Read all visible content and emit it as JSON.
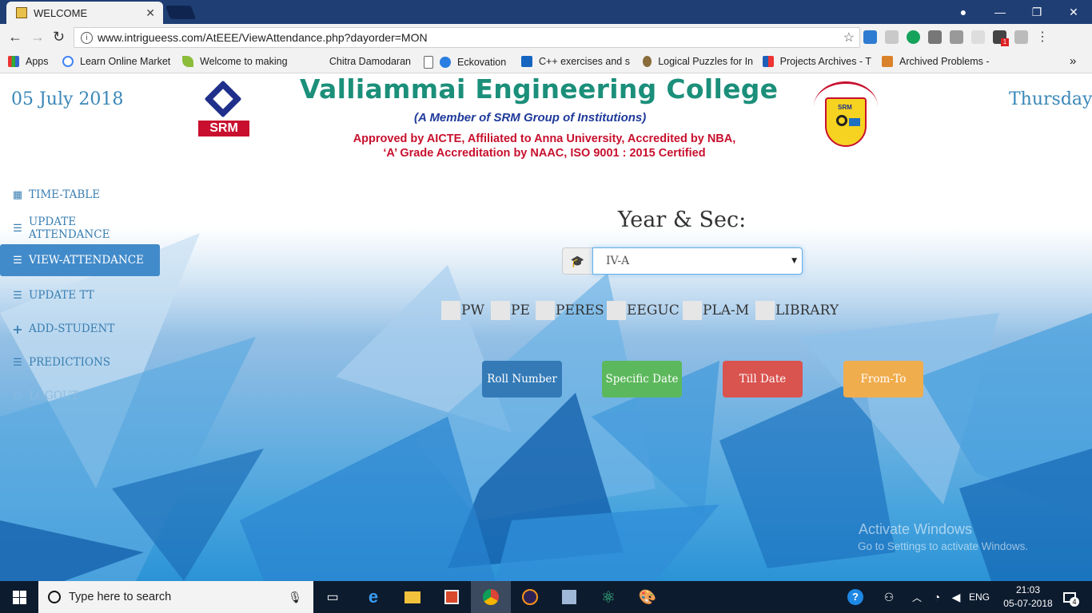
{
  "browser": {
    "tab_title": "WELCOME",
    "url": "www.intrigueess.com/AtEEE/ViewAttendance.php?dayorder=MON",
    "bookmarks": [
      {
        "label": "Apps"
      },
      {
        "label": "Learn Online Market"
      },
      {
        "label": "Welcome to making"
      },
      {
        "label": "Chitra Damodaran"
      },
      {
        "label": "Eckovation"
      },
      {
        "label": "C++ exercises and s"
      },
      {
        "label": "Logical Puzzles for In"
      },
      {
        "label": "Projects Archives - T"
      },
      {
        "label": "Archived Problems -"
      }
    ],
    "more": "»",
    "ext_badge": "1"
  },
  "header": {
    "date": "05 July 2018",
    "day": "Thursday",
    "college_name": "Valliammai Engineering College",
    "member_line": "(A Member of SRM Group of Institutions)",
    "approval_line1": "Approved by AICTE, Affiliated to Anna University, Accredited by NBA,",
    "approval_line2": "‘A’ Grade Accreditation by NAAC, ISO 9001 : 2015 Certified",
    "srm_logo_text": "SRM",
    "seal_text": "SRM"
  },
  "sidebar": {
    "items": [
      {
        "label": "TIME-TABLE",
        "icon": "calendar-icon"
      },
      {
        "label": "UPDATE ATTENDANCE",
        "icon": "list-icon"
      },
      {
        "label": "VIEW-ATTENDANCE",
        "icon": "list-icon",
        "active": true
      },
      {
        "label": "UPDATE TT",
        "icon": "list-icon"
      },
      {
        "label": "ADD-STUDENT",
        "icon": "plus-icon"
      },
      {
        "label": "PREDICTIONS",
        "icon": "list-icon"
      },
      {
        "label": "LOGOUT",
        "icon": "power-icon"
      }
    ]
  },
  "form": {
    "year_label": "Year & Sec:",
    "selected_section": "IV-A",
    "subjects": [
      "PW",
      "PE",
      "PERES",
      "EEGUC",
      "PLA-M",
      "LIBRARY"
    ],
    "buttons": {
      "roll_number": "Roll Number",
      "specific_date": "Specific Date",
      "till_date": "Till Date",
      "from_to": "From-To"
    },
    "button_colors": {
      "roll_number": "#337ab7",
      "specific_date": "#5cb85c",
      "till_date": "#d9534f",
      "from_to": "#f0ad4e"
    }
  },
  "watermark": {
    "line1": "Activate Windows",
    "line2": "Go to Settings to activate Windows."
  },
  "taskbar": {
    "search_placeholder": "Type here to search",
    "language": "ENG",
    "time": "21:03",
    "date": "05-07-2018",
    "notification_count": "4"
  }
}
